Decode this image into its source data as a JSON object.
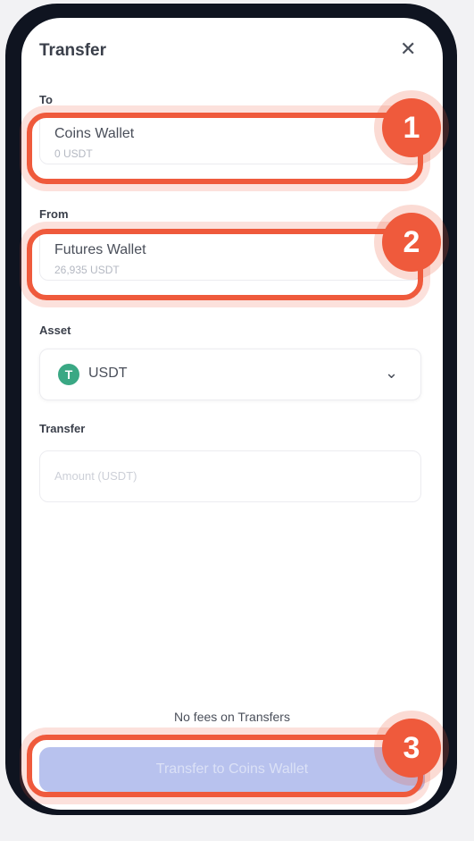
{
  "header": {
    "title": "Transfer",
    "close_icon": "close-icon"
  },
  "to": {
    "label": "To",
    "wallet": "Coins Wallet",
    "balance": "0 USDT"
  },
  "from": {
    "label": "From",
    "wallet": "Futures Wallet",
    "balance": "26,935 USDT"
  },
  "asset": {
    "label": "Asset",
    "selected": "USDT",
    "icon": "T"
  },
  "transfer": {
    "label": "Transfer",
    "placeholder": "Amount (USDT)"
  },
  "footer": {
    "note": "No fees on Transfers",
    "button_label": "Transfer to Coins Wallet"
  },
  "annotations": {
    "step1": "1",
    "step2": "2",
    "step3": "3"
  },
  "colors": {
    "highlight": "#ef5a3c",
    "button": "#b8c2ee",
    "tether": "#3aa884"
  }
}
